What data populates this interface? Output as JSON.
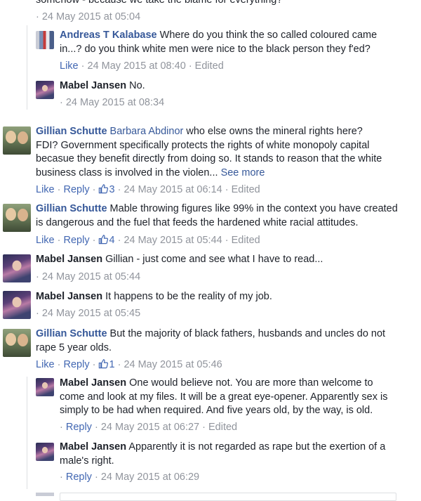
{
  "comments": [
    {
      "id": "c0",
      "text": "somehow - because we take the blame for everything?",
      "timestamp": "24 May 2015 at 05:04"
    },
    {
      "id": "c1",
      "author": "Andreas T Kalabase",
      "text": "Where do you think the so called coloured came in...? do you think white men were nice to the black person they f'ed?",
      "like": "Like",
      "timestamp": "24 May 2015 at 08:40",
      "edited": "Edited"
    },
    {
      "id": "c2",
      "author": "Mabel Jansen",
      "text": "No.",
      "timestamp": "24 May 2015 at 08:34"
    },
    {
      "id": "c3",
      "author": "Gillian Schutte",
      "mention": "Barbara Abdinor",
      "text": "who else owns the mineral rights here? FDI? Government specifically protects the rights of white monopoly capital becasue they benefit directly from doing so. It stands to reason that the white business class is involved in the violen...",
      "see_more": "See more",
      "like": "Like",
      "reply": "Reply",
      "likes": "3",
      "timestamp": "24 May 2015 at 06:14",
      "edited": "Edited"
    },
    {
      "id": "c4",
      "author": "Gillian Schutte",
      "text": "Mable throwing figures like 99% in the context you have created is dangerous and the fuel that feeds the hardened white racial attitudes.",
      "like": "Like",
      "reply": "Reply",
      "likes": "4",
      "timestamp": "24 May 2015 at 05:44",
      "edited": "Edited"
    },
    {
      "id": "c5",
      "author": "Mabel Jansen",
      "text": "Gillian - just come and see what I have to read...",
      "timestamp": "24 May 2015 at 05:44"
    },
    {
      "id": "c6",
      "author": "Mabel Jansen",
      "text": "It happens to be the reality of my job.",
      "timestamp": "24 May 2015 at 05:45"
    },
    {
      "id": "c7",
      "author": "Gillian Schutte",
      "text": "But the majority of black fathers, husbands and uncles do not rape 5 year olds.",
      "like": "Like",
      "reply": "Reply",
      "likes": "1",
      "timestamp": "24 May 2015 at 05:46"
    },
    {
      "id": "c8",
      "author": "Mabel Jansen",
      "text": "One would believe not. You are more than welcome to come and look at my files. It will be a great eye-opener. Apparently sex is simply to be had when required. And five years old, by the way, is old.",
      "reply": "Reply",
      "timestamp": "24 May 2015 at 06:27",
      "edited": "Edited"
    },
    {
      "id": "c9",
      "author": "Mabel Jansen",
      "text": "Apparently it is not regarded as rape but the exertion of a male's right.",
      "reply": "Reply",
      "timestamp": "24 May 2015 at 06:29"
    }
  ],
  "colors": {
    "link": "#365899",
    "action": "#4267b2",
    "meta": "#90949c",
    "text": "#1d2129"
  },
  "icons": {
    "like": "thumbs-up-icon"
  }
}
